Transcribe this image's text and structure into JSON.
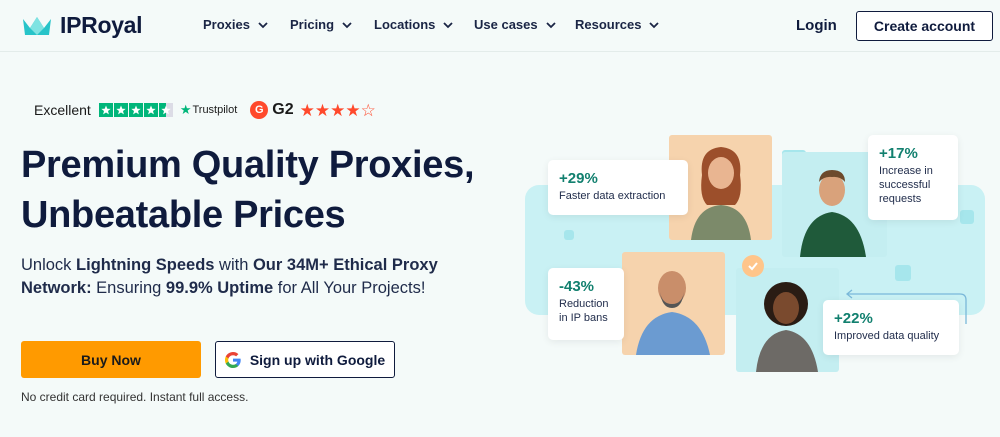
{
  "nav": {
    "brand": "IPRoyal",
    "menu": [
      {
        "label": "Proxies"
      },
      {
        "label": "Pricing"
      },
      {
        "label": "Locations"
      },
      {
        "label": "Use cases"
      },
      {
        "label": "Resources"
      }
    ],
    "login": "Login",
    "create_account": "Create account"
  },
  "ratings": {
    "excellent": "Excellent",
    "trustpilot": "Trustpilot",
    "g2": "G2"
  },
  "hero": {
    "title_line1": "Premium Quality Proxies,",
    "title_line2": "Unbeatable Prices",
    "sub": {
      "p1": "Unlock ",
      "b1": "Lightning Speeds",
      "p2": " with ",
      "b2": "Our 34M+ Ethical Proxy Network:",
      "p3": " Ensuring ",
      "b3": "99.9% Uptime",
      "p4": " for All Your Projects!"
    },
    "buy_now": "Buy Now",
    "google_signup": "Sign up with Google",
    "note": "No credit card required. Instant full access."
  },
  "stats": [
    {
      "pct": "+29%",
      "label": "Faster data extraction"
    },
    {
      "pct": "+17%",
      "label": "Increase in successful requests"
    },
    {
      "pct": "-43%",
      "label": "Reduction in IP bans"
    },
    {
      "pct": "+22%",
      "label": "Improved data quality"
    }
  ],
  "colors": {
    "navy": "#0f1b3d",
    "orange": "#ff9a00",
    "teal": "#12806f",
    "trustpilot": "#00b67a",
    "g2": "#ff492c",
    "bg": "#f4faf9"
  }
}
